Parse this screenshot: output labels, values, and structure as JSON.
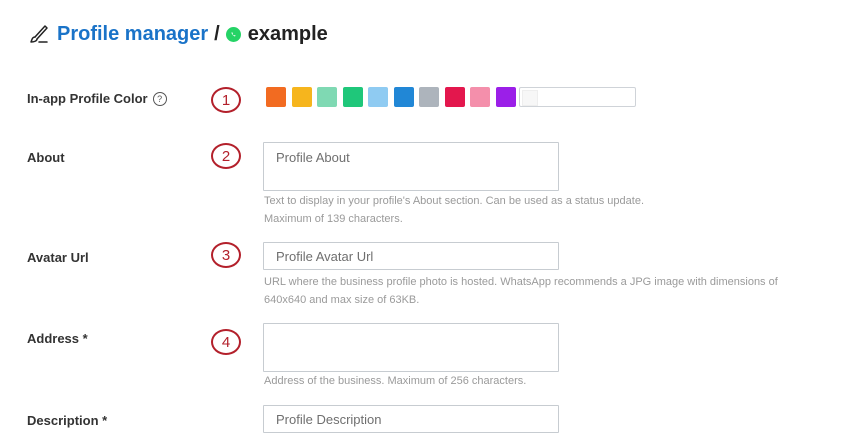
{
  "header": {
    "title": "Profile manager",
    "separator": "/",
    "page_name": "example"
  },
  "profile_color": {
    "label": "In-app Profile Color",
    "help_glyph": "?",
    "marker": "1",
    "swatches": [
      "#f26b21",
      "#f6b51d",
      "#7fd9b3",
      "#1fc77a",
      "#8fcbf2",
      "#2187d6",
      "#adb4bc",
      "#e3174d",
      "#f48fab",
      "#9b1fe8"
    ]
  },
  "about": {
    "label": "About",
    "marker": "2",
    "placeholder": "Profile About",
    "help_line1": "Text to display in your profile's About section. Can be used as a status update.",
    "help_line2": "Maximum of 139 characters."
  },
  "avatar": {
    "label": "Avatar Url",
    "marker": "3",
    "placeholder": "Profile Avatar Url",
    "help_line1": "URL where the business profile photo is hosted. WhatsApp recommends a JPG image with dimensions of",
    "help_line2": "640x640 and max size of 63KB."
  },
  "address": {
    "label": "Address *",
    "marker": "4",
    "placeholder": "",
    "help_line1": "Address of the business. Maximum of 256 characters."
  },
  "description": {
    "label": "Description *",
    "placeholder": "Profile Description"
  }
}
